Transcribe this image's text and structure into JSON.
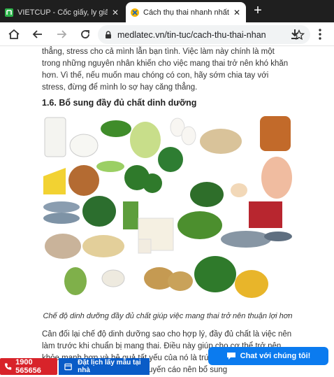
{
  "tabs": [
    {
      "title": "VIETCUP - Cốc giấy, ly giấy s",
      "active": false
    },
    {
      "title": "Cách thụ thai nhanh nhất ch",
      "active": true
    }
  ],
  "toolbar": {
    "url": "medlatec.vn/tin-tuc/cach-thu-thai-nhan"
  },
  "article": {
    "para1": "thẳng, stress cho cả mình lẫn bạn tình. Việc làm này chính là một trong những nguyên nhân khiến cho việc mang thai trở nên khó khăn hơn. Vì thế, nếu muốn mau chóng có con, hãy sớm chia tay với stress, đừng để mình lo sợ hay căng thẳng.",
    "heading": "1.6. Bổ sung đầy đủ chất dinh dưỡng",
    "caption": "Chế độ dinh dưỡng đầy đủ chất giúp việc mang thai trở nên thuận lợi hơn",
    "para2": "Cân đối lại chế độ dinh dưỡng sao cho hợp lý, đầy đủ chất là việc nên làm trước khi chuẩn bị mang thai. Điều này giúp cho cơ thể trở nên khỏe mạnh hơn và hệ quả tất yếu của nó là trứng và tinh trùng của bạn. Một số các chất được khuyến cáo nên bổ sung"
  },
  "floating": {
    "hotline": "1900 565656",
    "booking": "Đặt lịch lấy mẫu tại nhà",
    "chat": "Chat với chúng tôi!"
  },
  "colors": {
    "tabstrip": "#1f1f1f",
    "hotline": "#d8232a",
    "booking": "#0a5cc7",
    "chat": "#0b7bef"
  }
}
